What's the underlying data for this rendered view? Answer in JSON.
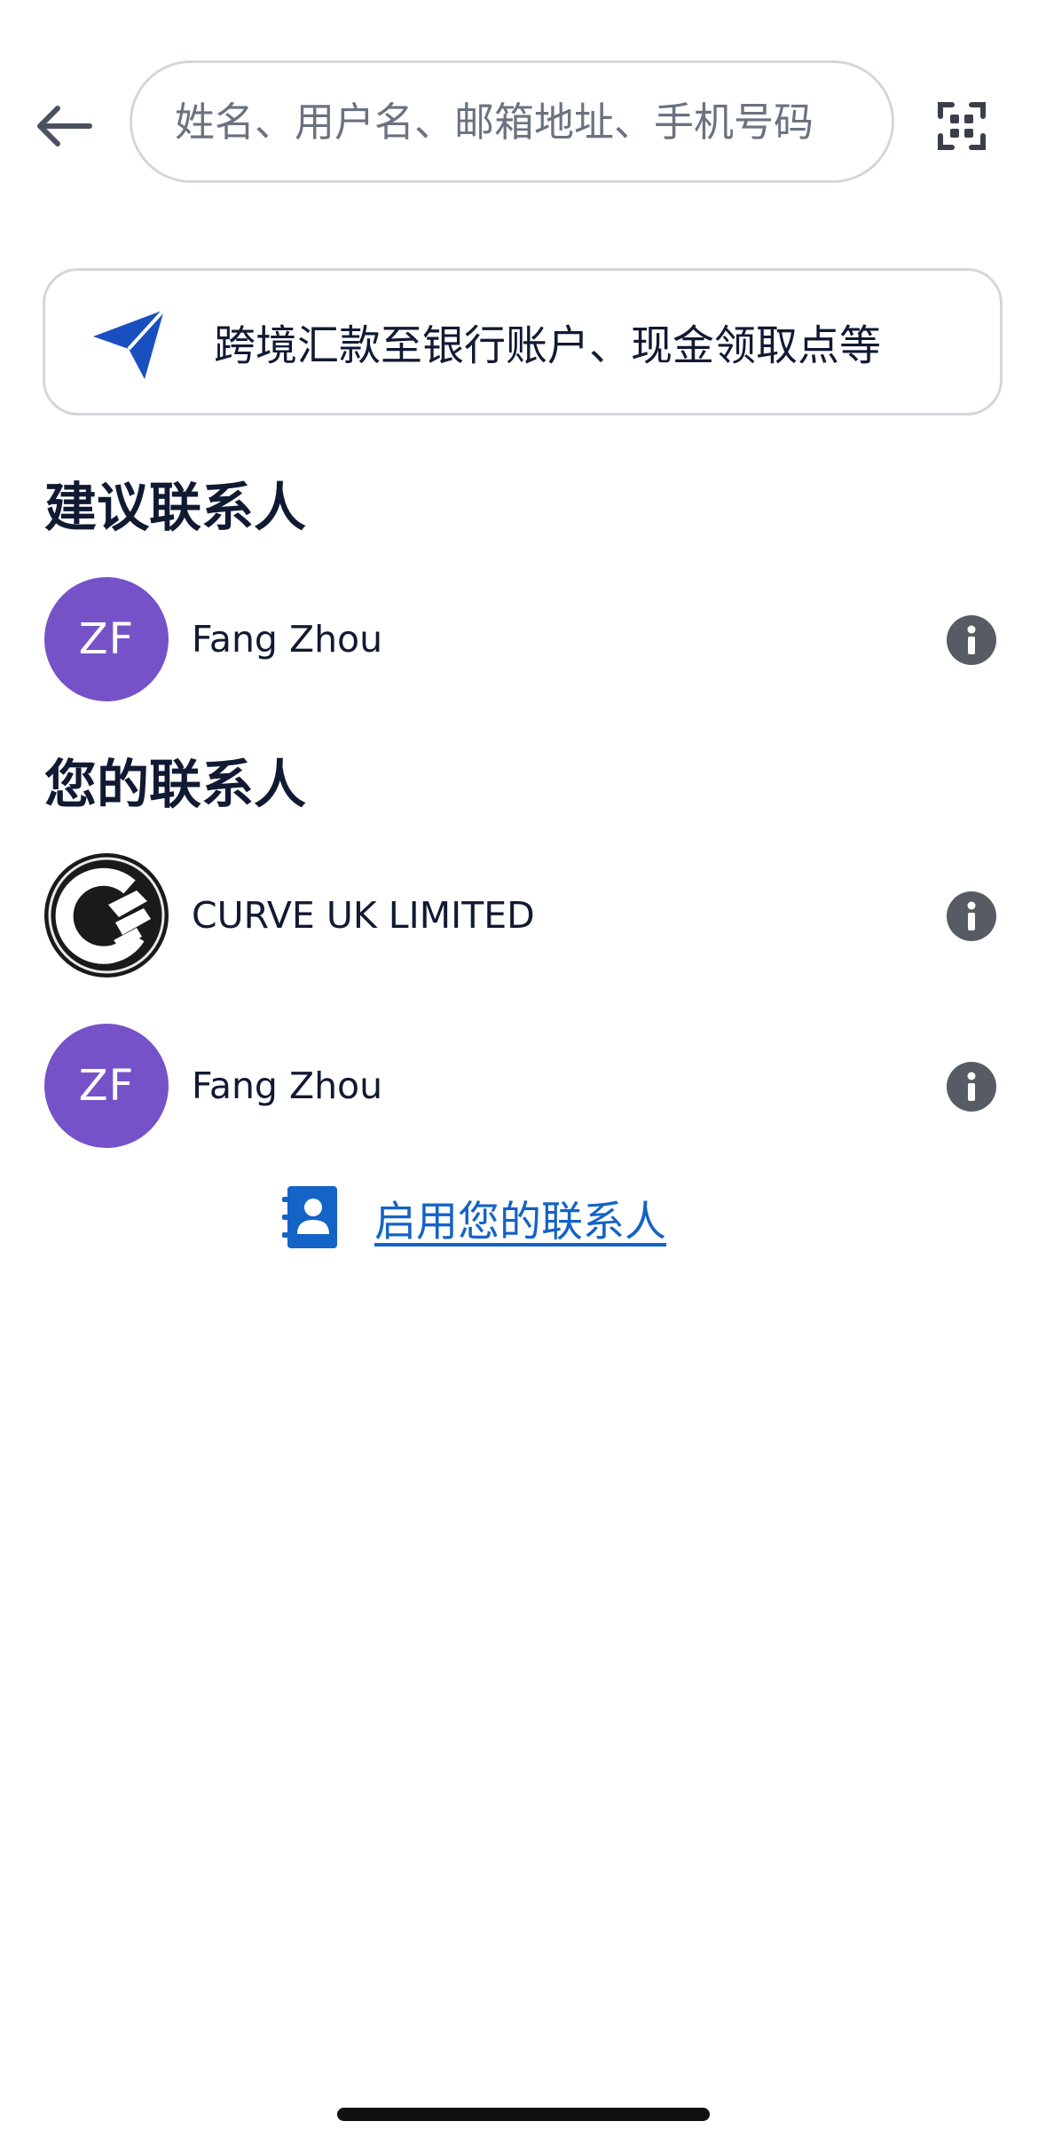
{
  "header": {
    "back_icon": "arrow-left-icon",
    "search_placeholder": "姓名、用户名、邮箱地址、手机号码",
    "search_value": "",
    "scan_icon": "qr-scan-icon"
  },
  "banner": {
    "icon": "paper-plane-icon",
    "label": "跨境汇款至银行账户、现金领取点等",
    "icon_color": "#1a4fbf"
  },
  "suggested": {
    "title": "建议联系人",
    "contacts": [
      {
        "initials": "ZF",
        "name": "Fang Zhou",
        "avatar_color": "#7652c8"
      }
    ]
  },
  "your_contacts": {
    "title": "您的联系人",
    "contacts": [
      {
        "initials": "",
        "name": "CURVE UK LIMITED",
        "avatar_icon": "curve-logo-icon",
        "avatar_color": "#1a1a1a"
      },
      {
        "initials": "ZF",
        "name": "Fang Zhou",
        "avatar_color": "#7652c8"
      }
    ]
  },
  "enable_contacts": {
    "icon": "address-book-icon",
    "label": "启用您的联系人",
    "color": "#1463c6"
  },
  "colors": {
    "text_primary": "#111a33",
    "border": "#d3d6dc",
    "info_icon": "#575b64",
    "link": "#1463c6"
  }
}
